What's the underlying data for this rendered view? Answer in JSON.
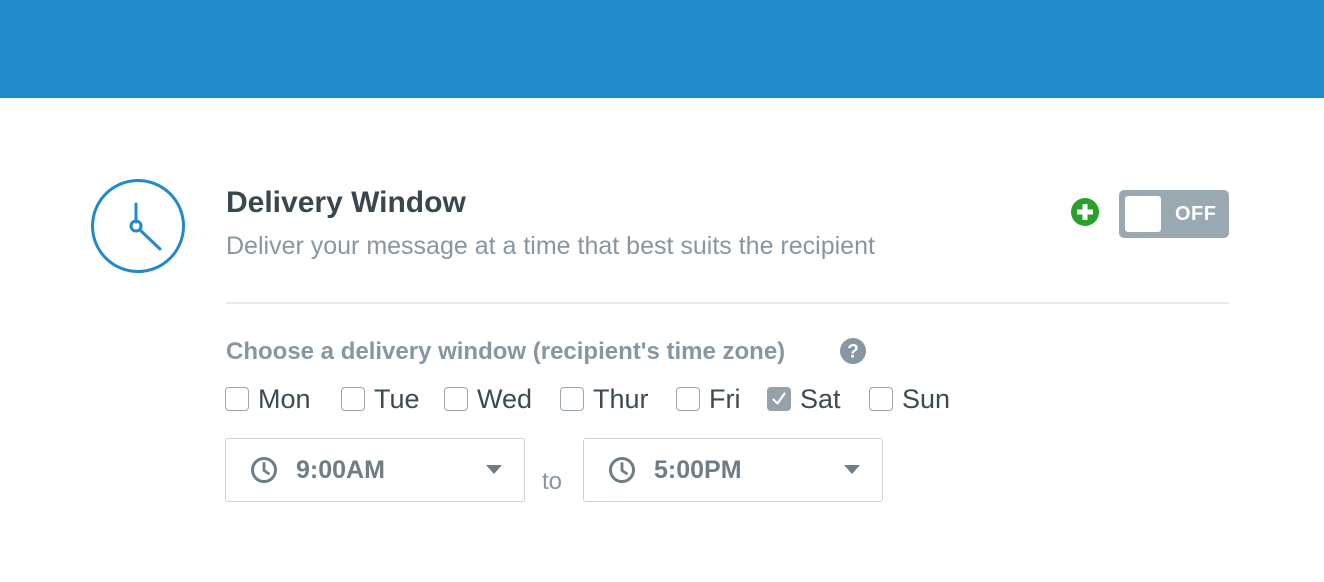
{
  "colors": {
    "header_bar": "#2289cb",
    "accent": "#2289cb",
    "add_green": "#2aa02c",
    "toggle_off": "#9aa8b2"
  },
  "section": {
    "icon": "clock-icon",
    "title": "Delivery Window",
    "subtitle": "Deliver your message at a time that best suits the recipient",
    "add_icon": "plus-circle-icon",
    "toggle": {
      "state_label": "OFF",
      "on": false
    }
  },
  "window": {
    "label": "Choose a delivery window (recipient's time zone)",
    "help_icon": "question-circle-icon",
    "days": [
      {
        "label": "Mon",
        "checked": false
      },
      {
        "label": "Tue",
        "checked": false
      },
      {
        "label": "Wed",
        "checked": false
      },
      {
        "label": "Thur",
        "checked": false
      },
      {
        "label": "Fri",
        "checked": false
      },
      {
        "label": "Sat",
        "checked": true
      },
      {
        "label": "Sun",
        "checked": false
      }
    ],
    "start_time": "9:00AM",
    "separator": "to",
    "end_time": "5:00PM"
  }
}
